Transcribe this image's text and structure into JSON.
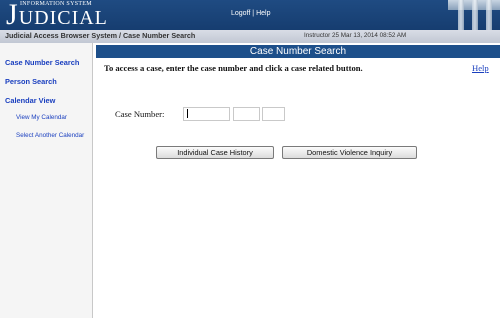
{
  "header": {
    "logo_top": "INFORMATION SYSTEM",
    "logo_first_letter": "J",
    "logo_rest": "UDICIAL",
    "logoff": "Logoff",
    "separator": "|",
    "help": "Help"
  },
  "subheader": {
    "breadcrumb": "Judicial Access Browser System / Case Number Search",
    "user_info": "Instructor 25   Mar 13, 2014 08:52 AM"
  },
  "sidebar": {
    "case_number_search": "Case Number Search",
    "person_search": "Person Search",
    "calendar_view": "Calendar View",
    "view_my_calendar": "View My Calendar",
    "select_another_calendar": "Select Another Calendar"
  },
  "main": {
    "title": "Case Number Search",
    "instructions": "To access a case, enter the case number and click a case related button.",
    "help": "Help",
    "case_number_label": "Case Number:",
    "case_fields": [
      "",
      "",
      ""
    ],
    "individual_case_history": "Individual Case History",
    "domestic_violence_inquiry": "Domestic Violence Inquiry"
  },
  "colors": {
    "header": "#1f4b82",
    "title_bar": "#1d4f8a",
    "link": "#1a3fbf"
  }
}
